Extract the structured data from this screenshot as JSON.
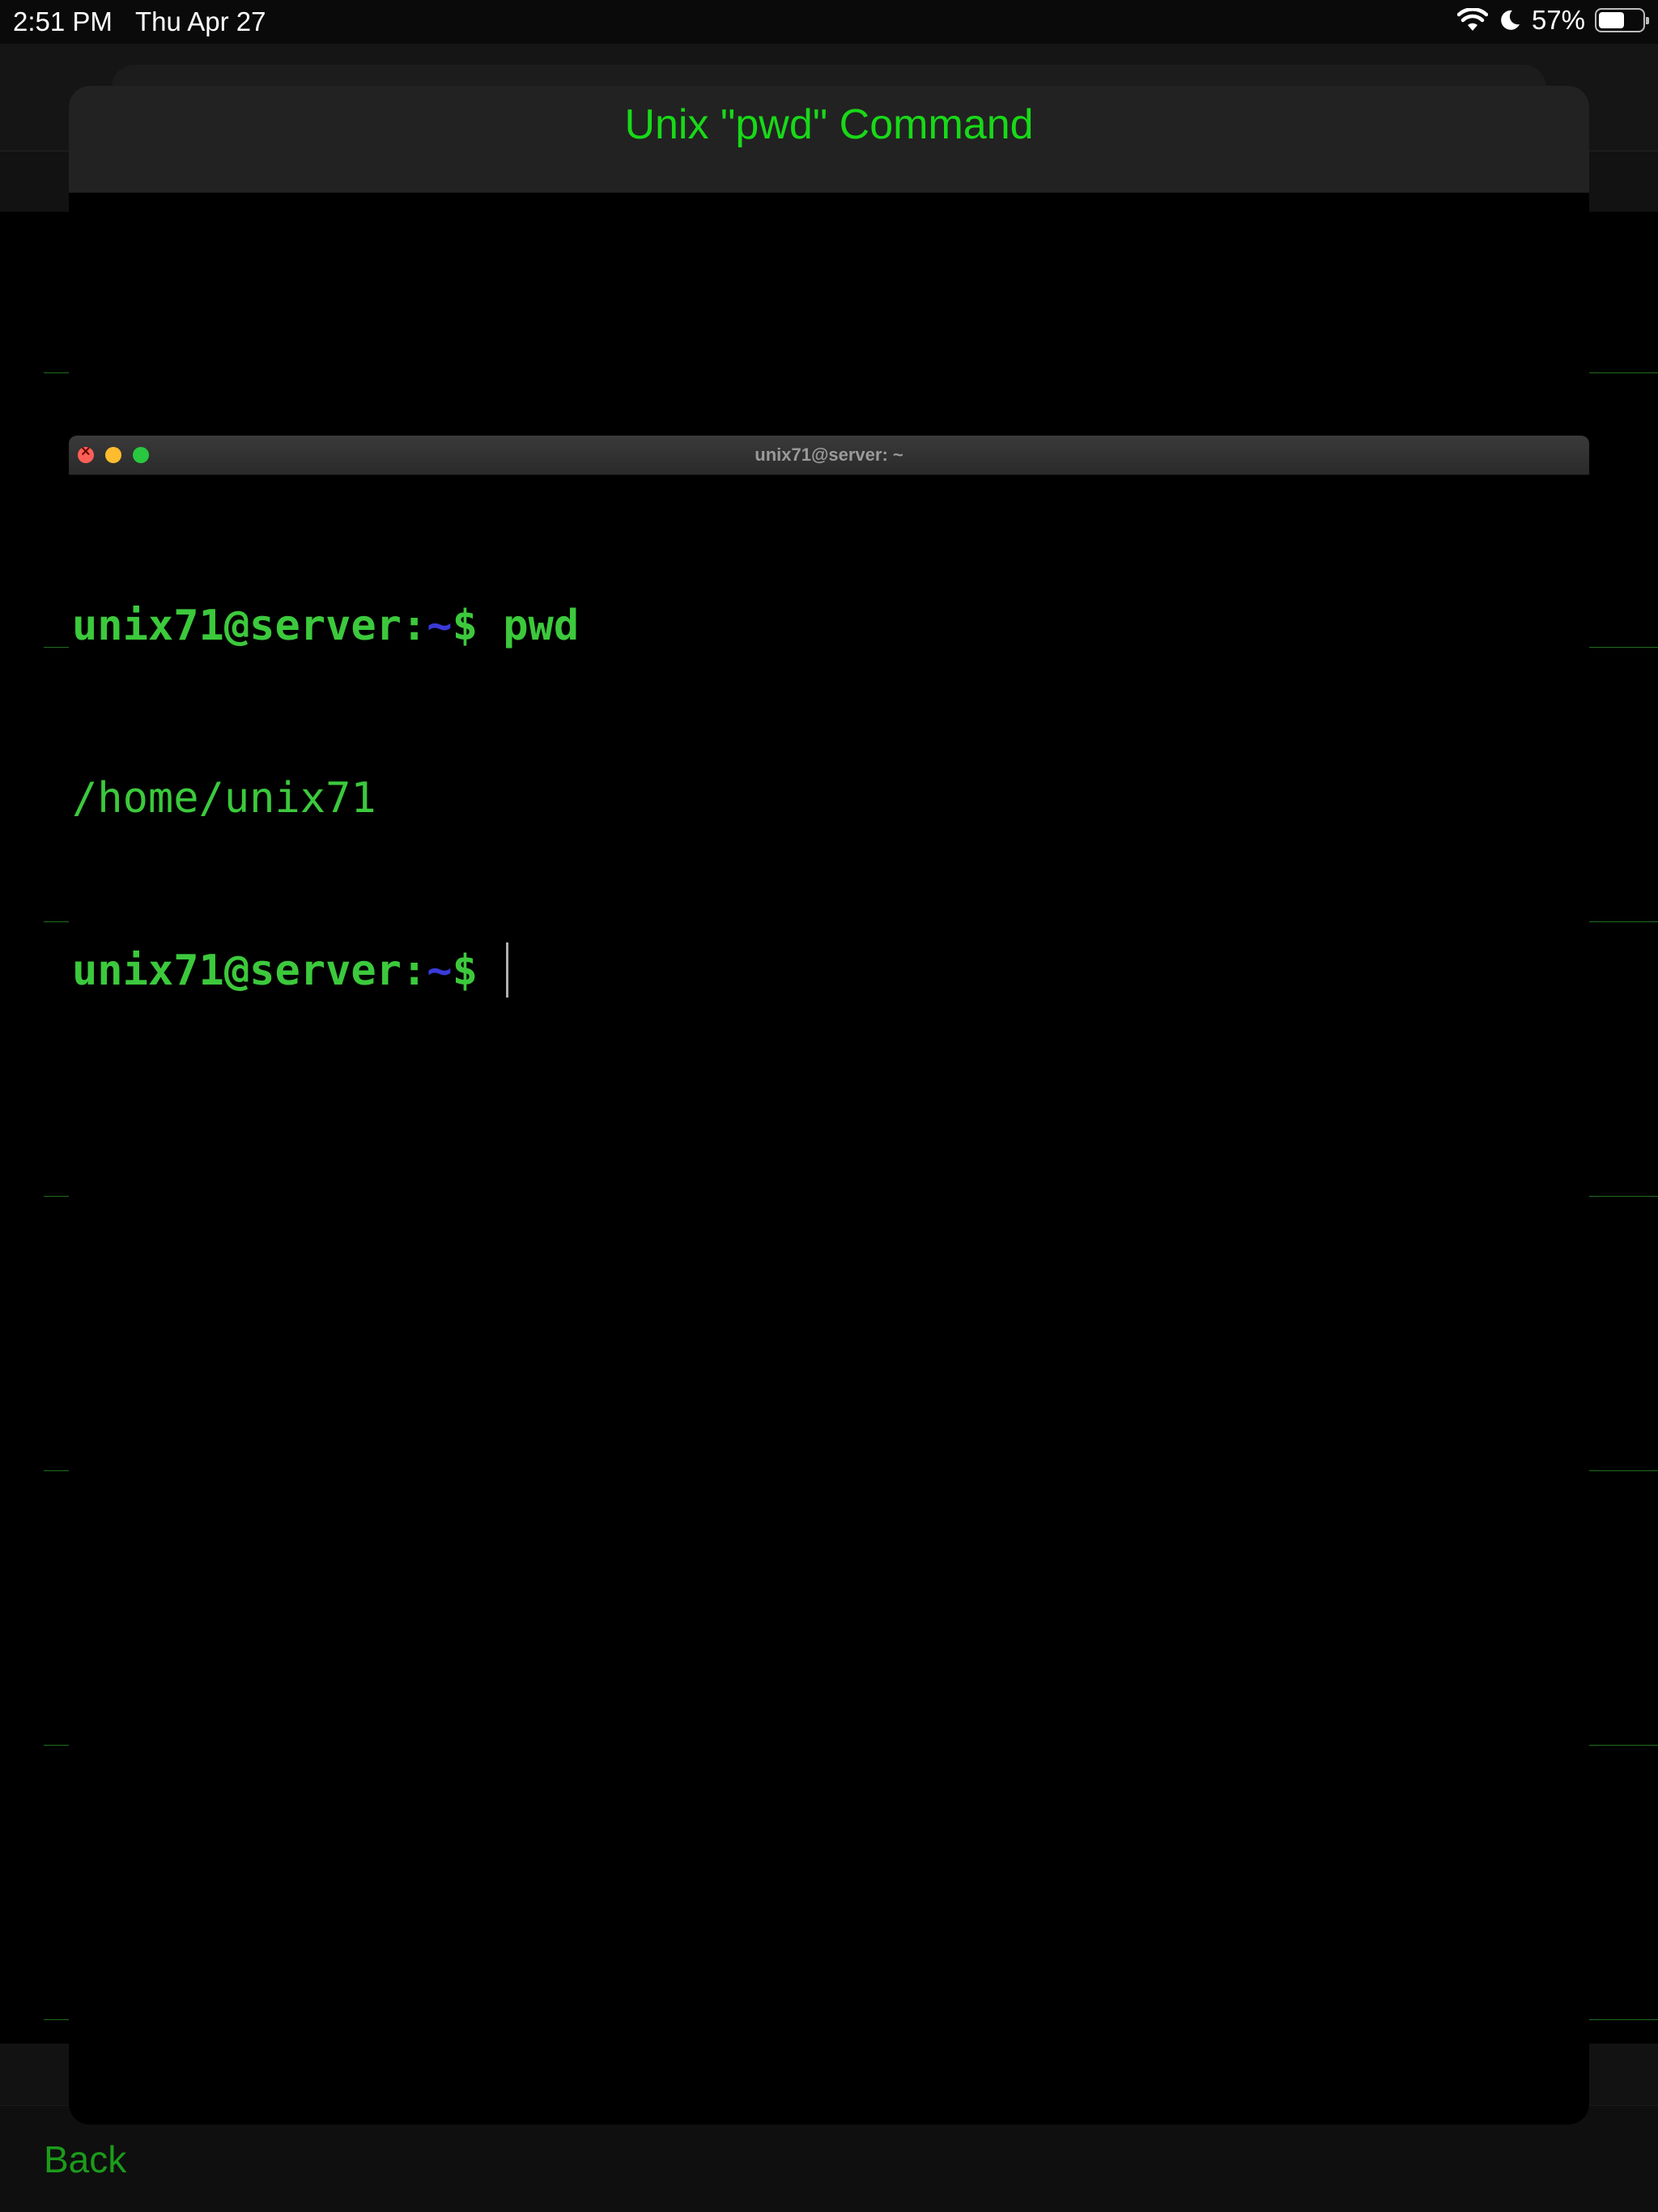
{
  "status_bar": {
    "time": "2:51 PM",
    "date": "Thu Apr 27",
    "battery_percent": "57%",
    "battery_level": 0.57,
    "icons": [
      "wifi-icon",
      "moon-icon",
      "battery-icon"
    ]
  },
  "sheet": {
    "title": "Unix \"pwd\" Command"
  },
  "terminal": {
    "window_title": "unix71@server: ~",
    "lines": [
      {
        "user": "unix71@server:",
        "path": "~",
        "sign": "$",
        "command": " pwd"
      },
      {
        "output": "/home/unix71"
      },
      {
        "user": "unix71@server:",
        "path": "~",
        "sign": "$",
        "command": " "
      }
    ]
  },
  "nav": {
    "back_label": "Back"
  },
  "colors": {
    "accent_green": "#18d918",
    "terminal_green": "#3cc93c",
    "path_blue": "#3a3ad8",
    "back_green": "#1b9b1b"
  }
}
